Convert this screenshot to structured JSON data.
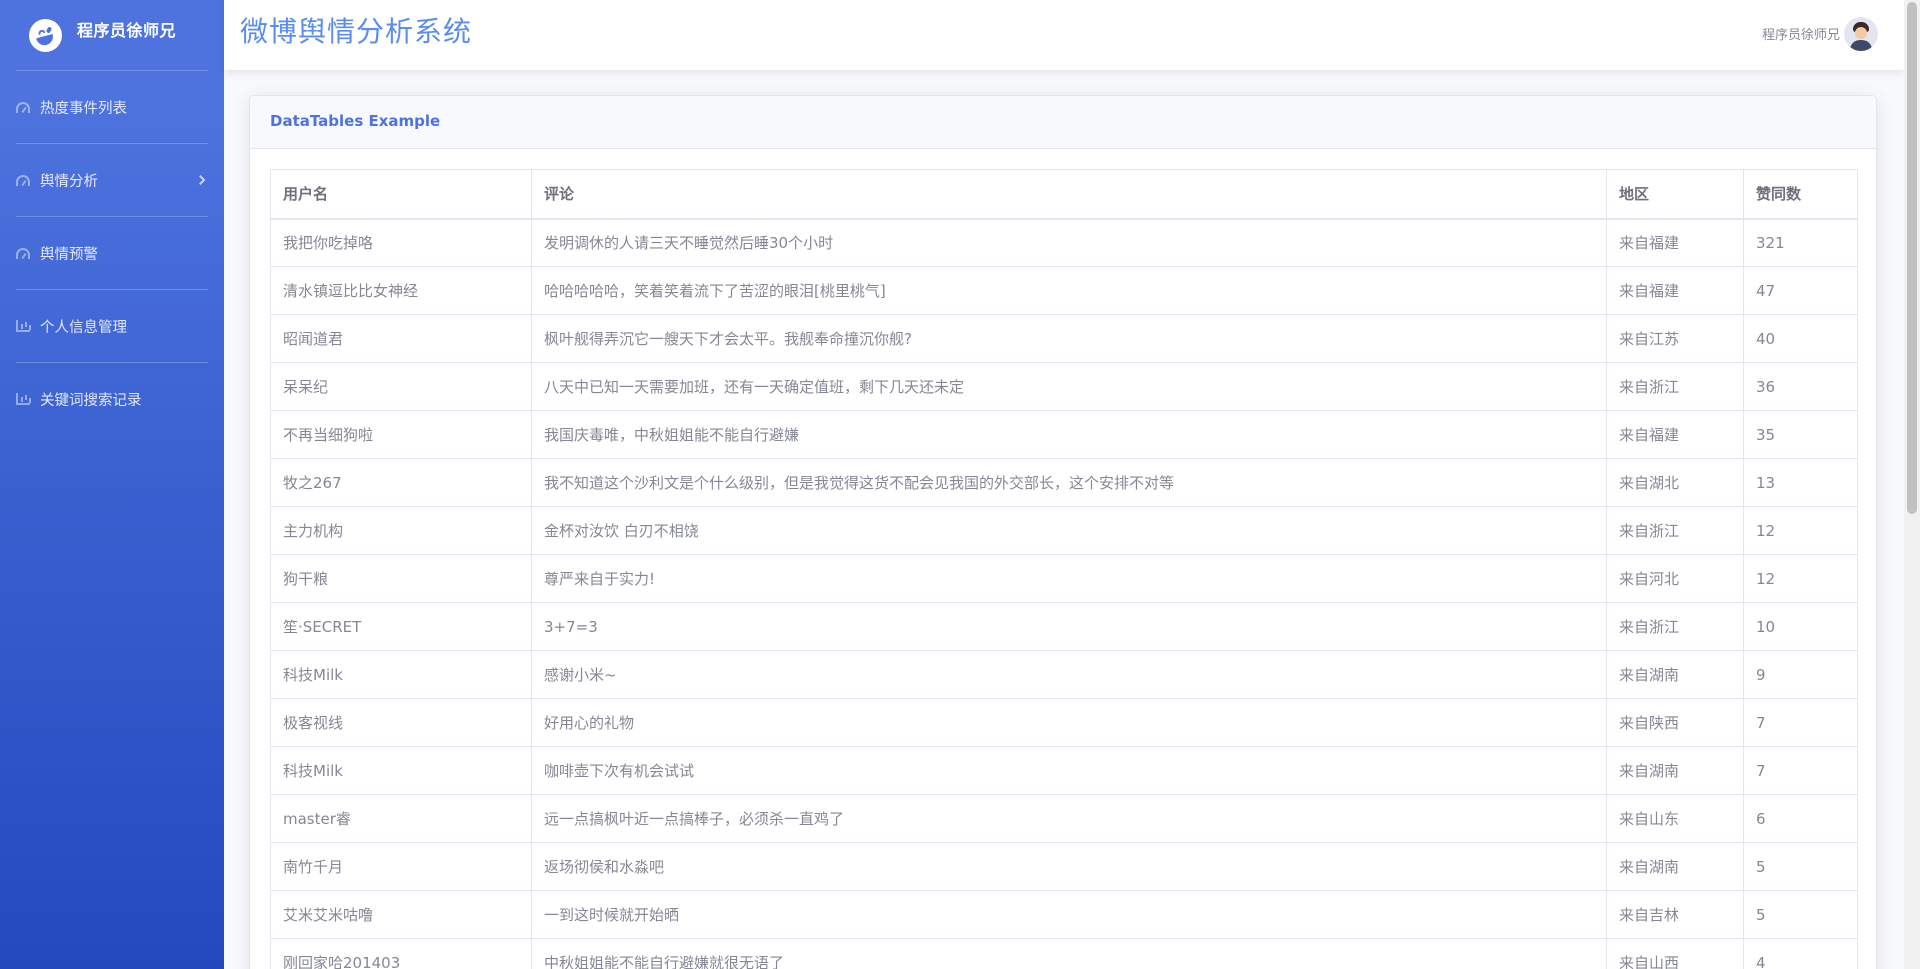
{
  "brand": {
    "name": "程序员徐师兄",
    "logo_icon": "laugh-wink-icon"
  },
  "sidebar": {
    "items": [
      {
        "label": "热度事件列表",
        "icon": "tachometer-icon",
        "has_arrow": false
      },
      {
        "label": "舆情分析",
        "icon": "tachometer-icon",
        "has_arrow": true
      },
      {
        "label": "舆情预警",
        "icon": "tachometer-icon",
        "has_arrow": false
      },
      {
        "label": "个人信息管理",
        "icon": "chart-area-icon",
        "has_arrow": false
      },
      {
        "label": "关键词搜索记录",
        "icon": "chart-area-icon",
        "has_arrow": false
      }
    ]
  },
  "header": {
    "title": "微博舆情分析系统",
    "user_name": "程序员徐师兄"
  },
  "card": {
    "title": "DataTables Example"
  },
  "table": {
    "columns": [
      "用户名",
      "评论",
      "地区",
      "赞同数"
    ],
    "rows": [
      [
        "我把你吃掉咯",
        "发明调休的人请三天不睡觉然后睡30个小时",
        "来自福建",
        "321"
      ],
      [
        "清水镇逗比比女神经",
        "哈哈哈哈哈，笑着笑着流下了苦涩的眼泪[桃里桃气]",
        "来自福建",
        "47"
      ],
      [
        "昭闻道君",
        "枫叶舰得弄沉它一艘天下才会太平。我舰奉命撞沉你舰?",
        "来自江苏",
        "40"
      ],
      [
        "呆呆纪",
        "八天中已知一天需要加班，还有一天确定值班，剩下几天还未定",
        "来自浙江",
        "36"
      ],
      [
        "不再当细狗啦",
        "我国庆毒唯，中秋姐姐能不能自行避嫌",
        "来自福建",
        "35"
      ],
      [
        "牧之267",
        "我不知道这个沙利文是个什么级别，但是我觉得这货不配会见我国的外交部长，这个安排不对等",
        "来自湖北",
        "13"
      ],
      [
        "主力机构",
        "金杯对汝饮 白刃不相饶",
        "来自浙江",
        "12"
      ],
      [
        "狗干粮",
        "尊严来自于实力!",
        "来自河北",
        "12"
      ],
      [
        "笙·SECRET",
        "3+7=3",
        "来自浙江",
        "10"
      ],
      [
        "科技Milk",
        "感谢小米~",
        "来自湖南",
        "9"
      ],
      [
        "极客视线",
        "好用心的礼物",
        "来自陕西",
        "7"
      ],
      [
        "科技Milk",
        "咖啡壶下次有机会试试",
        "来自湖南",
        "7"
      ],
      [
        "master睿",
        "远一点搞枫叶近一点搞棒子，必须杀一直鸡了",
        "来自山东",
        "6"
      ],
      [
        "南竹千月",
        "返场彻侯和水淼吧",
        "来自湖南",
        "5"
      ],
      [
        "艾米艾米咕噜",
        "一到这时候就开始晒",
        "来自吉林",
        "5"
      ],
      [
        "刚回家哈201403",
        "中秋姐姐能不能自行避嫌就很无语了",
        "来自山西",
        "4"
      ]
    ]
  }
}
